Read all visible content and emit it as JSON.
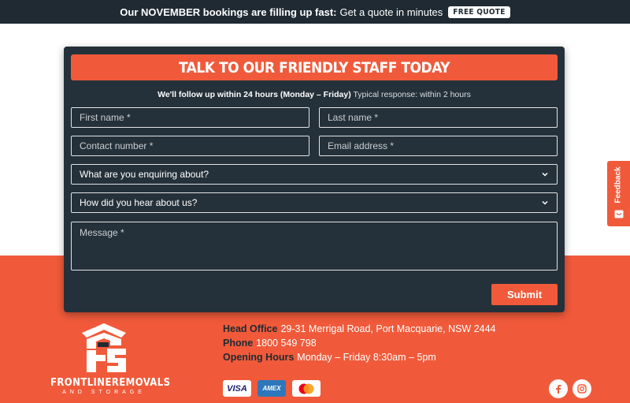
{
  "announcement": {
    "strong": "Our NOVEMBER bookings are filling up fast:",
    "text": "Get a quote in minutes",
    "cta": "FREE QUOTE"
  },
  "form": {
    "title": "TALK TO OUR FRIENDLY STAFF TODAY",
    "follow_up_bold": "We'll follow up within 24 hours (Monday – Friday)",
    "follow_up_note": "Typical response: within 2 hours",
    "first_name_placeholder": "First name *",
    "last_name_placeholder": "Last name *",
    "contact_number_placeholder": "Contact number *",
    "email_placeholder": "Email address *",
    "enquiry_select": "What are you enquiring about?",
    "hear_select": "How did you hear about us?",
    "message_placeholder": "Message *",
    "submit_label": "Submit"
  },
  "feedback_tab": {
    "label": "Feedback",
    "icon": "feedback-icon"
  },
  "footer": {
    "logo_text": "FRONTLINEREMOVALS",
    "logo_subtext": "AND STORAGE",
    "head_office_label": "Head Office",
    "head_office_value": "29-31 Merrigal Road, Port Macquarie, NSW 2444",
    "phone_label": "Phone",
    "phone_value": "1800 549 798",
    "hours_label": "Opening Hours",
    "hours_value": "Monday – Friday 8:30am – 5pm",
    "payment_cards": [
      "VISA",
      "AMEX",
      "mastercard"
    ],
    "social": [
      "facebook-icon",
      "instagram-icon"
    ]
  },
  "colors": {
    "brand_orange": "#f05a3a",
    "dark_navy": "#1f2a33",
    "card_bg": "#25313a"
  }
}
